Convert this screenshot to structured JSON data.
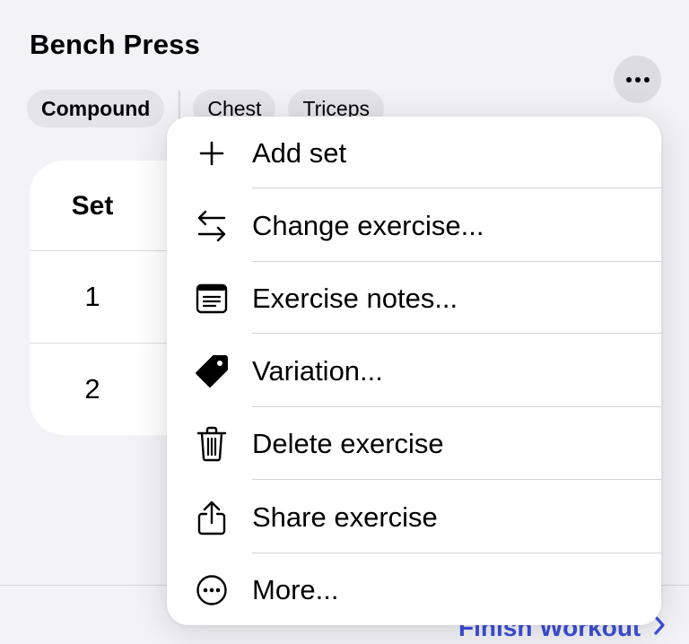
{
  "exercise": {
    "title": "Bench Press",
    "tags": [
      {
        "label": "Compound",
        "bold": true
      },
      {
        "label": "Chest",
        "bold": false
      },
      {
        "label": "Triceps",
        "bold": false
      }
    ],
    "more_icon": "ellipsis-icon"
  },
  "sets_table": {
    "header": "Set",
    "rows": [
      "1",
      "2"
    ]
  },
  "menu": {
    "items": [
      {
        "label": "Add set",
        "icon": "plus-icon"
      },
      {
        "label": "Change exercise...",
        "icon": "arrows-swap-icon"
      },
      {
        "label": "Exercise notes...",
        "icon": "notes-icon"
      },
      {
        "label": "Variation...",
        "icon": "tag-icon"
      },
      {
        "label": "Delete exercise",
        "icon": "trash-icon"
      },
      {
        "label": "Share exercise",
        "icon": "share-icon"
      },
      {
        "label": "More...",
        "icon": "ellipsis-circle-icon"
      }
    ]
  },
  "footer": {
    "finish_label": "Finish Workout",
    "finish_icon": "chevron-right-icon"
  },
  "colors": {
    "background": "#f2f2f7",
    "accent": "#3c4fd8",
    "card": "#ffffff"
  }
}
